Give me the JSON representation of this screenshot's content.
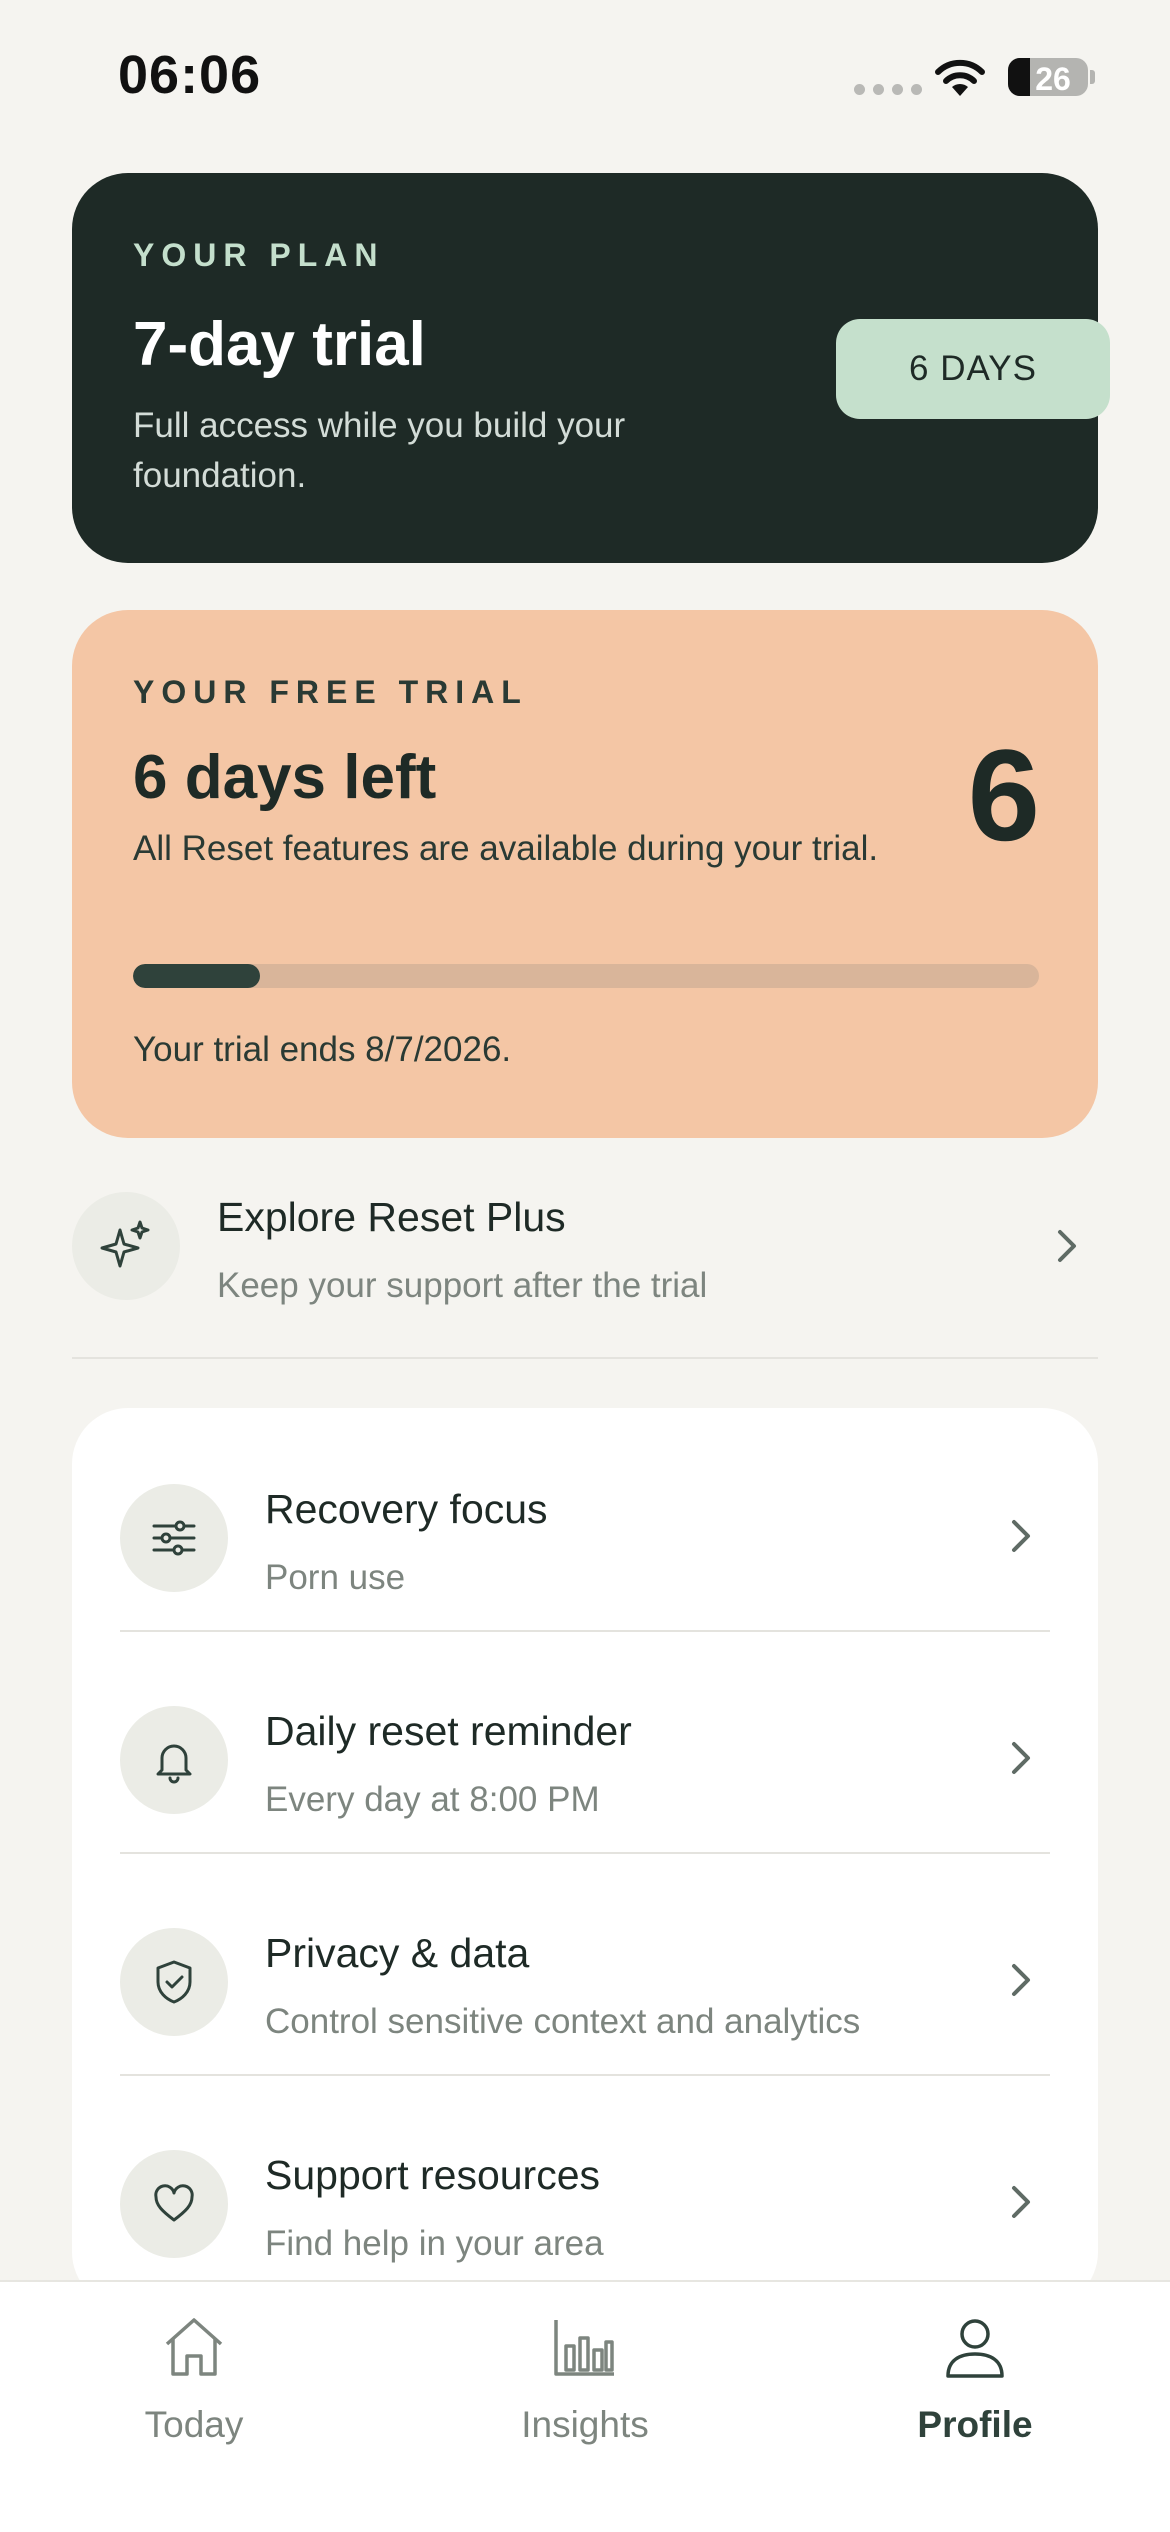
{
  "status_bar": {
    "time": "06:06",
    "battery": "26"
  },
  "plan_card": {
    "eyebrow": "YOUR PLAN",
    "title": "7-day trial",
    "description": "Full access while you build your foundation.",
    "days_badge": "6 DAYS"
  },
  "trial_card": {
    "eyebrow": "YOUR FREE TRIAL",
    "title": "6 days left",
    "big_number": "6",
    "description": "All Reset features are available during your trial.",
    "progress_fraction": 0.14,
    "ends_text": "Your trial ends 8/7/2026."
  },
  "explore": {
    "title": "Explore Reset Plus",
    "subtitle": "Keep your support after the trial",
    "icon": "sparkles-icon"
  },
  "settings": [
    {
      "title": "Recovery focus",
      "subtitle": "Porn use",
      "icon": "sliders-icon"
    },
    {
      "title": "Daily reset reminder",
      "subtitle": "Every day at 8:00 PM",
      "icon": "bell-icon"
    },
    {
      "title": "Privacy & data",
      "subtitle": "Control sensitive context and analytics",
      "icon": "shield-check-icon"
    },
    {
      "title": "Support resources",
      "subtitle": "Find help in your area",
      "icon": "heart-icon"
    }
  ],
  "tabs": [
    {
      "label": "Today",
      "icon": "home-icon",
      "active": false
    },
    {
      "label": "Insights",
      "icon": "bar-chart-icon",
      "active": false
    },
    {
      "label": "Profile",
      "icon": "person-icon",
      "active": true
    }
  ],
  "colors": {
    "background": "#f5f4f0",
    "plan_card": "#1e2a26",
    "trial_card": "#f4c6a5",
    "badge": "#c5e0cc",
    "accent": "#2f423b"
  }
}
